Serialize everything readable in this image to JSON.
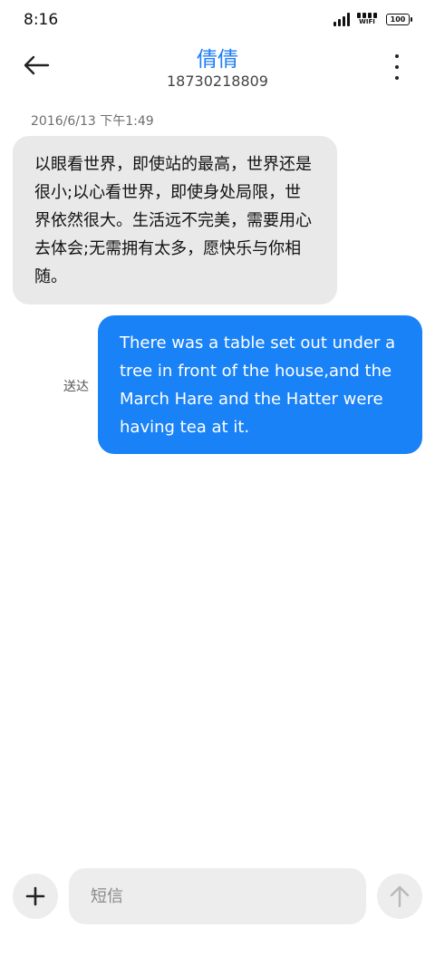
{
  "status_bar": {
    "time": "8:16",
    "wifi_label": "WIFI",
    "battery_level": "100"
  },
  "header": {
    "contact_name": "倩倩",
    "contact_number": "18730218809"
  },
  "conversation": {
    "timestamp": "2016/6/13 下午1:49",
    "incoming_message": "以眼看世界，即使站的最高，世界还是很小;以心看世界，即使身处局限，世界依然很大。生活远不完美，需要用心去体会;无需拥有太多，愿快乐与你相随。",
    "outgoing_message": "There was a table set out under a tree in front of the house,and the March Hare and the Hatter were having tea at it.",
    "delivery_status": "送达"
  },
  "composer": {
    "placeholder": "短信",
    "value": ""
  },
  "colors": {
    "accent": "#1f7ef5",
    "outgoing_bubble": "#1a82f7",
    "incoming_bubble": "#e9e9e9"
  },
  "icons": {
    "back": "arrow-left-icon",
    "more": "more-vertical-icon",
    "add": "plus-icon",
    "send": "arrow-up-icon"
  }
}
